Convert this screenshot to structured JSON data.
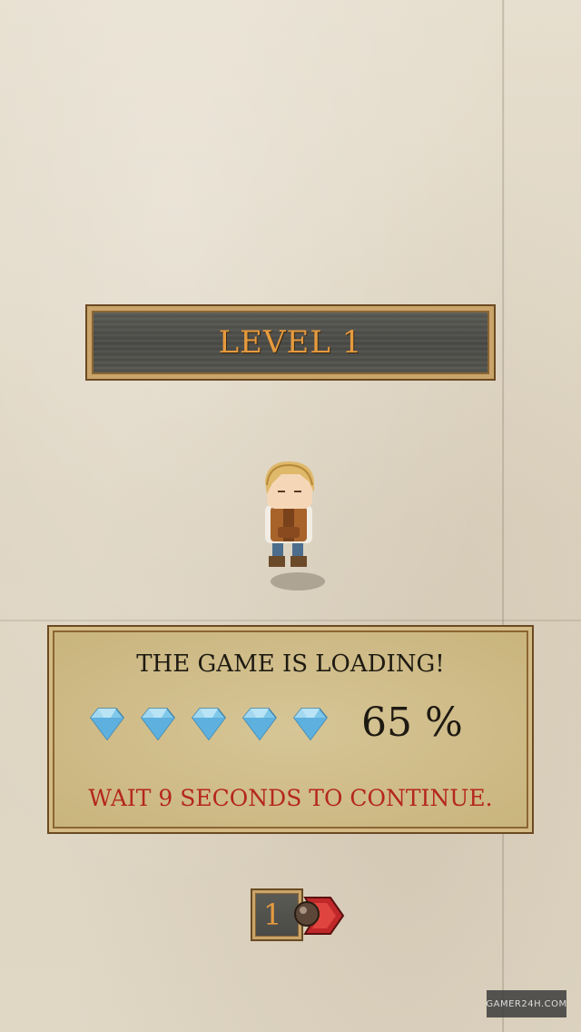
{
  "level": {
    "title": "LEVEL 1"
  },
  "loading": {
    "title": "THE GAME IS LOADING!",
    "gems": [
      "diamond-icon",
      "diamond-icon",
      "diamond-icon",
      "diamond-icon",
      "diamond-icon"
    ],
    "percent_label": "65 %",
    "progress": 0.65,
    "wait_text": "WAIT 9 SECONDS TO CONTINUE."
  },
  "counter": {
    "value": "1",
    "icon": "bomb-icon",
    "next_icon": "chevron-right-icon"
  },
  "watermark": {
    "text": "GAMER24H.COM"
  },
  "colors": {
    "paper": "#e2d9c8",
    "banner_wood": "#4a4a46",
    "banner_text": "#e59a3f",
    "panel": "#c9b47d",
    "frame_gold": "#c9a56b",
    "warning_red": "#b5261e",
    "gem_blue": "#7fc8ea"
  }
}
